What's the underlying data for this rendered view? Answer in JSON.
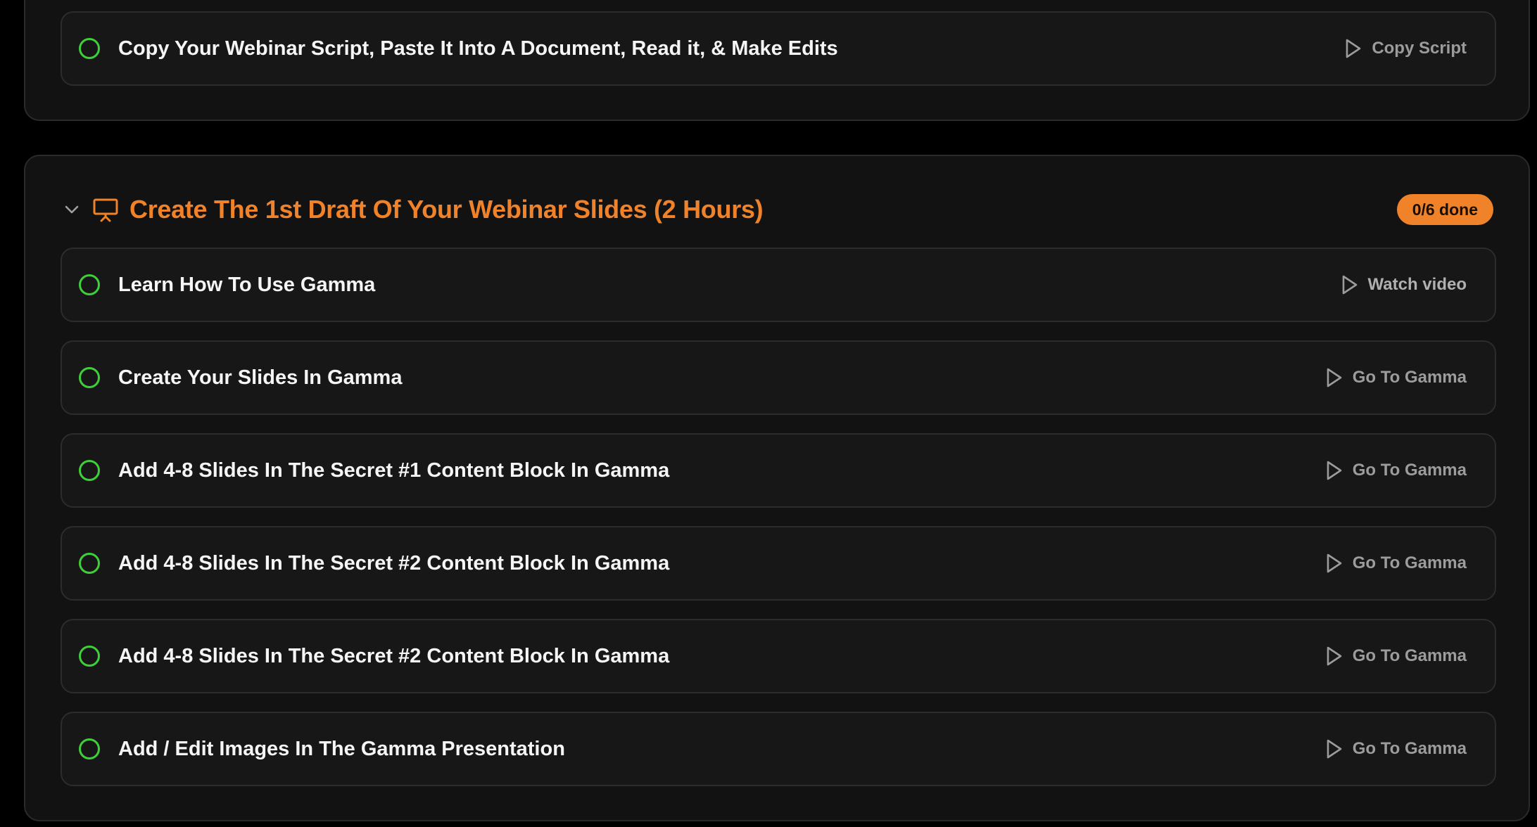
{
  "colors": {
    "accent_orange": "#f0832a",
    "check_green": "#3fcf3a",
    "muted_text": "#9c9c9c"
  },
  "top_section": {
    "tasks": [
      {
        "label": "Copy Your Webinar Script, Paste It Into A Document, Read it, & Make Edits",
        "action": "Copy Script",
        "action_icon": "play-icon"
      }
    ]
  },
  "main_section": {
    "toggle_icon": "chevron-down-icon",
    "header_icon": "presentation-icon",
    "title": "Create The 1st Draft Of Your Webinar Slides (2 Hours)",
    "badge": "0/6 done",
    "tasks": [
      {
        "label": "Learn How To Use Gamma",
        "action": "Watch video",
        "action_icon": "play-icon"
      },
      {
        "label": "Create Your Slides In Gamma",
        "action": "Go To Gamma",
        "action_icon": "play-icon"
      },
      {
        "label": "Add 4-8 Slides In The Secret #1 Content Block In Gamma",
        "action": "Go To Gamma",
        "action_icon": "play-icon"
      },
      {
        "label": "Add 4-8 Slides In The Secret #2 Content Block In Gamma",
        "action": "Go To Gamma",
        "action_icon": "play-icon"
      },
      {
        "label": "Add 4-8 Slides In The Secret #2 Content Block In Gamma",
        "action": "Go To Gamma",
        "action_icon": "play-icon"
      },
      {
        "label": "Add / Edit Images In The Gamma Presentation",
        "action": "Go To Gamma",
        "action_icon": "play-icon"
      }
    ]
  }
}
